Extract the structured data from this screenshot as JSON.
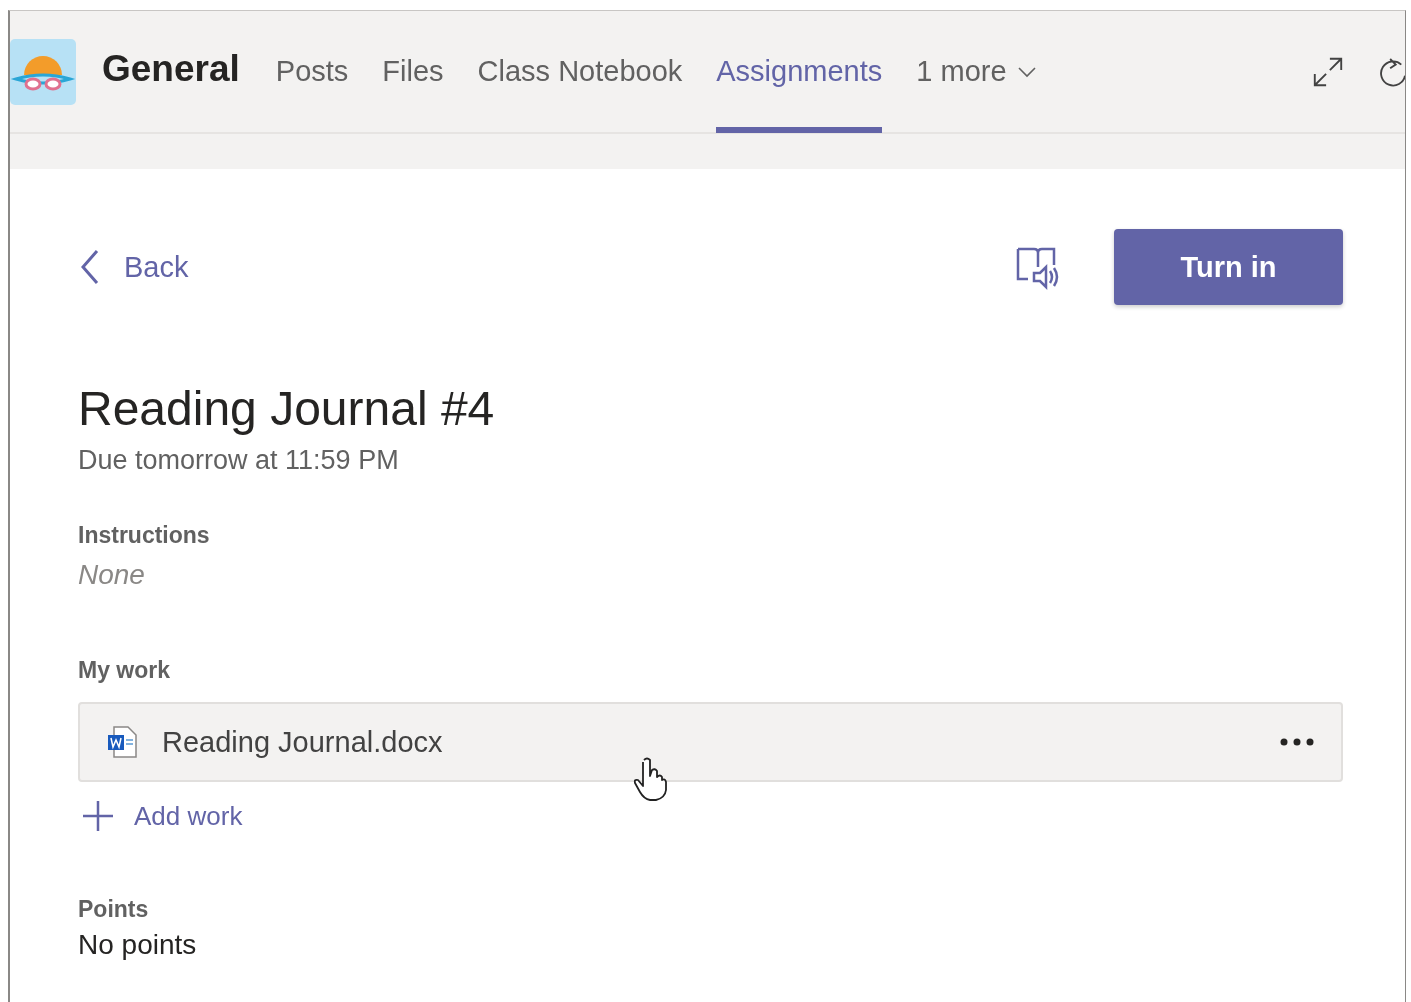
{
  "header": {
    "channel": "General",
    "tabs": [
      {
        "label": "Posts",
        "selected": false
      },
      {
        "label": "Files",
        "selected": false
      },
      {
        "label": "Class Notebook",
        "selected": false
      },
      {
        "label": "Assignments",
        "selected": true
      }
    ],
    "more": "1 more"
  },
  "back": "Back",
  "turn_in": "Turn in",
  "title": "Reading Journal #4",
  "due": "Due tomorrow at 11:59 PM",
  "instructions": {
    "label": "Instructions",
    "value": "None"
  },
  "my_work": {
    "label": "My work",
    "files": [
      {
        "name": "Reading Journal.docx"
      }
    ],
    "add": "Add work"
  },
  "points": {
    "label": "Points",
    "value": "No points"
  }
}
